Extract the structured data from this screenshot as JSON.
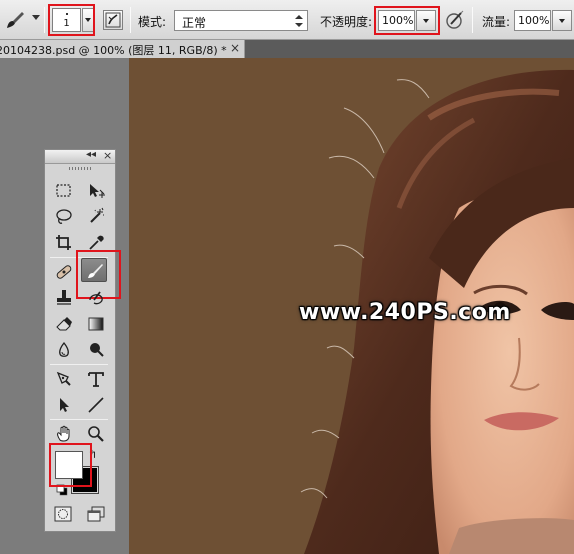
{
  "options_bar": {
    "brush_size": "1",
    "mode_label": "模式:",
    "mode_value": "正常",
    "opacity_label": "不透明度:",
    "opacity_value": "100%",
    "flow_label": "流量:",
    "flow_value": "100%"
  },
  "document_tab": {
    "title": "20104238.psd @ 100% (图层 11, RGB/8) *",
    "close_glyph": "×"
  },
  "canvas": {
    "watermark": "www.240PS.com",
    "background_color": "#6e5034"
  },
  "toolbox": {
    "collapse_glyph": "◂◂",
    "close_glyph": "×",
    "tools": [
      [
        "rectangular-marquee-icon",
        "move-icon"
      ],
      [
        "lasso-icon",
        "magic-wand-icon"
      ],
      [
        "crop-icon",
        "eyedropper-icon"
      ],
      [
        "healing-brush-icon",
        "brush-icon"
      ],
      [
        "clone-stamp-icon",
        "history-brush-icon"
      ],
      [
        "eraser-icon",
        "gradient-icon"
      ],
      [
        "blur-icon",
        "dodge-icon"
      ],
      [
        "pen-icon",
        "type-icon"
      ],
      [
        "path-selection-icon",
        "line-icon"
      ],
      [
        "hand-icon",
        "zoom-icon"
      ]
    ],
    "active_tool": "brush-icon",
    "foreground_color": "#ffffff",
    "background_color": "#000000",
    "swap_glyph": "↰"
  },
  "highlight_color": "#e0141c"
}
